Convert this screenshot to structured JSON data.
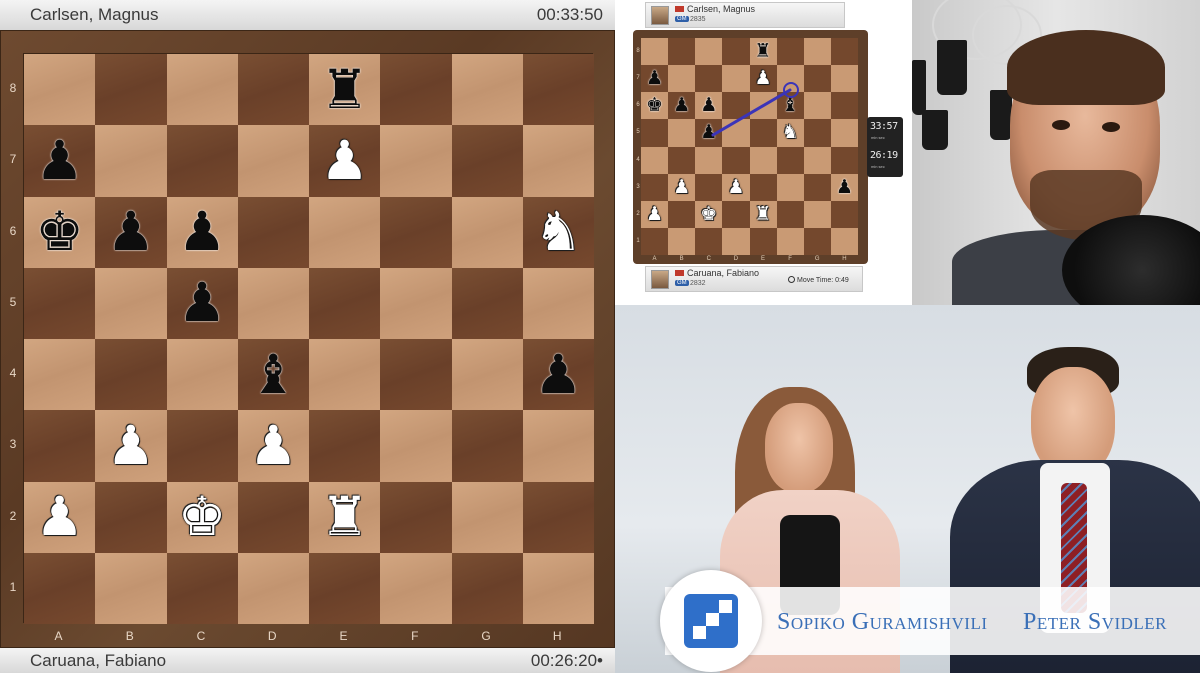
{
  "main_board": {
    "top_player": {
      "name": "Carlsen, Magnus",
      "clock": "00:33:50"
    },
    "bottom_player": {
      "name": "Caruana, Fabiano",
      "clock": "00:26:20•"
    },
    "ranks": [
      "8",
      "7",
      "6",
      "5",
      "4",
      "3",
      "2",
      "1"
    ],
    "files": [
      "A",
      "B",
      "C",
      "D",
      "E",
      "F",
      "G",
      "H"
    ],
    "pieces": {
      "e8": {
        "glyph": "♜",
        "color": "b",
        "name": "black-rook"
      },
      "a7": {
        "glyph": "♟",
        "color": "b",
        "name": "black-pawn"
      },
      "e7": {
        "glyph": "♟",
        "color": "w",
        "name": "white-pawn"
      },
      "a6": {
        "glyph": "♚",
        "color": "b",
        "name": "black-king"
      },
      "b6": {
        "glyph": "♟",
        "color": "b",
        "name": "black-pawn"
      },
      "c6": {
        "glyph": "♟",
        "color": "b",
        "name": "black-pawn"
      },
      "h6": {
        "glyph": "♞",
        "color": "w",
        "name": "white-knight"
      },
      "c5": {
        "glyph": "♟",
        "color": "b",
        "name": "black-pawn"
      },
      "d4": {
        "glyph": "♝",
        "color": "b",
        "name": "black-bishop"
      },
      "h4": {
        "glyph": "♟",
        "color": "b",
        "name": "black-pawn"
      },
      "b3": {
        "glyph": "♟",
        "color": "w",
        "name": "white-pawn"
      },
      "d3": {
        "glyph": "♟",
        "color": "w",
        "name": "white-pawn"
      },
      "a2": {
        "glyph": "♟",
        "color": "w",
        "name": "white-pawn"
      },
      "c2": {
        "glyph": "♚",
        "color": "w",
        "name": "white-king"
      },
      "e2": {
        "glyph": "♜",
        "color": "w",
        "name": "white-rook"
      }
    }
  },
  "mini_board": {
    "top_player": {
      "name": "Carlsen, Magnus",
      "title": "GM",
      "rating": "2835"
    },
    "bottom_player": {
      "name": "Caruana, Fabiano",
      "title": "GM",
      "rating": "2832",
      "move_time": "Move Time: 0:49"
    },
    "ranks": [
      "8",
      "7",
      "6",
      "5",
      "4",
      "3",
      "2",
      "1"
    ],
    "files": [
      "A",
      "B",
      "C",
      "D",
      "E",
      "F",
      "G",
      "H"
    ],
    "clock_top": "33:57",
    "clock_bottom": "26:19",
    "clock_units_top": "min   sec",
    "clock_units_bottom": "min   sec",
    "arrow_color": "#3b34b8",
    "pieces": {
      "e8": {
        "glyph": "♜",
        "color": "b"
      },
      "a7": {
        "glyph": "♟",
        "color": "b"
      },
      "e7": {
        "glyph": "♟",
        "color": "w"
      },
      "a6": {
        "glyph": "♚",
        "color": "b"
      },
      "b6": {
        "glyph": "♟",
        "color": "b"
      },
      "c6": {
        "glyph": "♟",
        "color": "b"
      },
      "f6": {
        "glyph": "♝",
        "color": "b"
      },
      "c5": {
        "glyph": "♟",
        "color": "b"
      },
      "f5": {
        "glyph": "♞",
        "color": "w"
      },
      "h3": {
        "glyph": "♟",
        "color": "b"
      },
      "b3": {
        "glyph": "♟",
        "color": "w"
      },
      "d3": {
        "glyph": "♟",
        "color": "w"
      },
      "a2": {
        "glyph": "♟",
        "color": "w"
      },
      "c2": {
        "glyph": "♚",
        "color": "w"
      },
      "e2": {
        "glyph": "♜",
        "color": "w"
      }
    }
  },
  "studio": {
    "hosts": [
      "Sopiko Guramishvili",
      "Peter Svidler"
    ],
    "brand_color": "#2f6fc9",
    "name_color": "#3a6fb7"
  }
}
